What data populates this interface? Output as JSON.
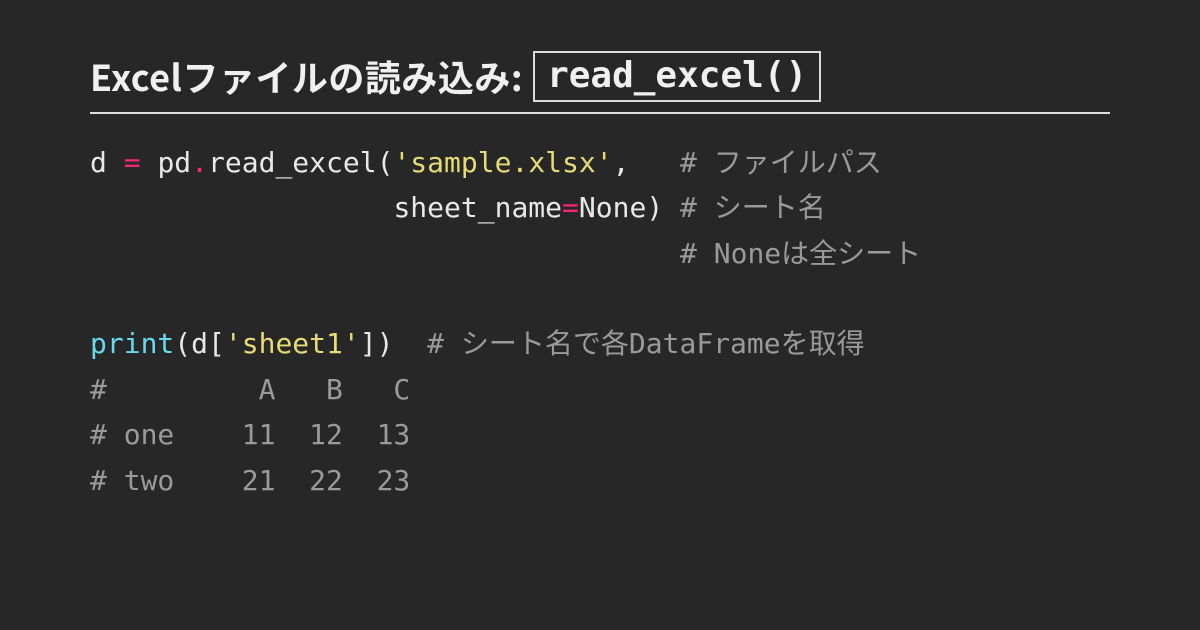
{
  "title": "Excelファイルの読み込み: ",
  "title_code": "read_excel()",
  "code": {
    "l1_var": "d ",
    "l1_eq": "= ",
    "l1_mod": "pd",
    "l1_dot": ".",
    "l1_fn": "read_excel(",
    "l1_arg": "'sample.xlsx'",
    "l1_comma": ",",
    "l1_pad": "   ",
    "l1_c": "# ファイルパス",
    "l2_indent": "                  ",
    "l2_kw": "sheet_name",
    "l2_eq": "=",
    "l2_none": "None",
    "l2_close": ") ",
    "l2_c": "# シート名",
    "l3_indent": "                                   ",
    "l3_c": "# Noneは全シート",
    "blank": "",
    "l4_fn": "print",
    "l4_open": "(d[",
    "l4_key": "'sheet1'",
    "l4_close": "])  ",
    "l4_c": "# シート名で各DataFrameを取得",
    "l5": "#         A   B   C",
    "l6": "# one    11  12  13",
    "l7": "# two    21  22  23"
  }
}
